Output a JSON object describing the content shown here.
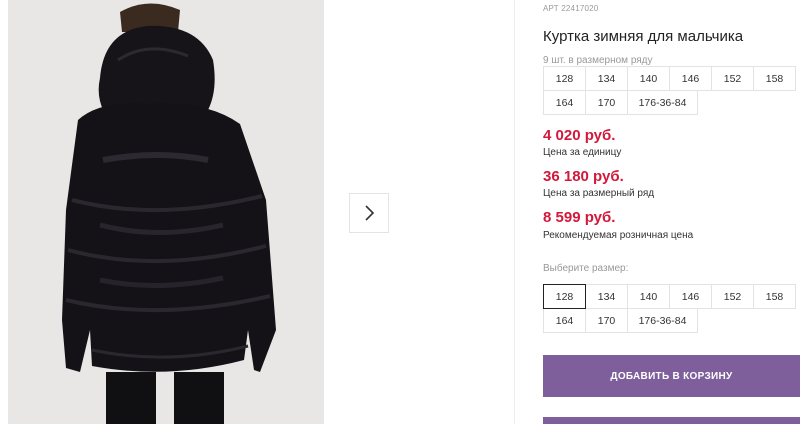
{
  "product": {
    "article_label": "АРТ",
    "article_code": "22417020",
    "title": "Куртка зимняя для мальчика",
    "pack_note": "9 шт. в размерном ряду"
  },
  "size_row": {
    "sizes": [
      "128",
      "134",
      "140",
      "146",
      "152",
      "158",
      "164",
      "170",
      "176-36-84"
    ]
  },
  "prices": {
    "unit_price": "4 020 руб.",
    "unit_label": "Цена за единицу",
    "row_price": "36 180 руб.",
    "row_label": "Цена за размерный ряд",
    "retail_price": "8 599 руб.",
    "retail_label": "Рекомендуемая розничная цена",
    "price_color": "#d3183a"
  },
  "size_select": {
    "label": "Выберите размер:",
    "selected": "128",
    "options": [
      "128",
      "134",
      "140",
      "146",
      "152",
      "158",
      "164",
      "170",
      "176-36-84"
    ]
  },
  "actions": {
    "add_to_cart": "ДОБАВИТЬ В КОРЗИНУ",
    "button_color": "#7e5f9c"
  },
  "gallery": {
    "next_icon": "chevron-right-icon"
  }
}
